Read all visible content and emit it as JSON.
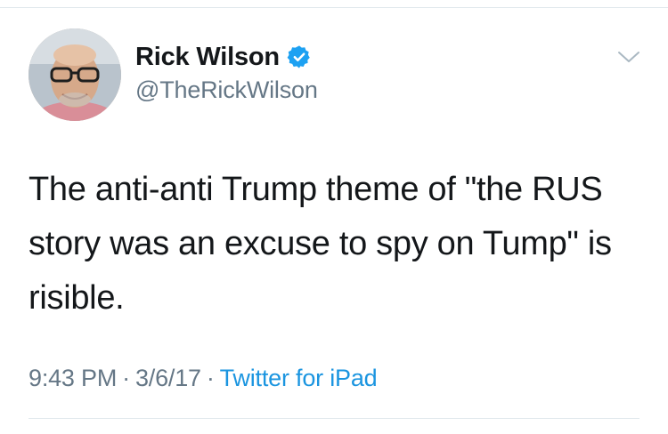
{
  "tweet": {
    "author": {
      "display_name": "Rick Wilson",
      "handle": "@TheRickWilson",
      "verified": true
    },
    "text": "The anti-anti Trump theme of \"the RUS story was an excuse to spy on Tump\" is risible.",
    "meta": {
      "time": "9:43 PM",
      "separator": "·",
      "date": "3/6/17",
      "source": "Twitter for iPad"
    }
  },
  "icons": {
    "verified": "verified-badge-icon",
    "menu": "chevron-down-icon"
  },
  "colors": {
    "accent": "#1da1f2",
    "source_link": "#1b95e0",
    "primary_text": "#14171a",
    "secondary_text": "#657786",
    "divider": "#e1e8ed"
  }
}
